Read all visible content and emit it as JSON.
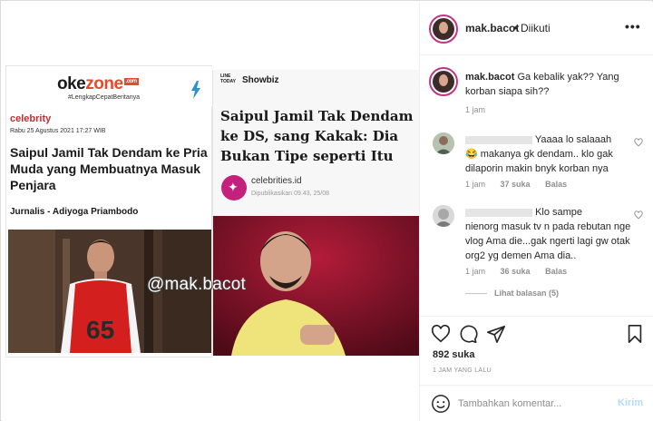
{
  "left_article": {
    "brand_oke": "OKE",
    "brand_zone": "ZONE",
    "brand_badge": ".com",
    "tagline": "#LengkapCepatBeritanya",
    "category": "celebrity",
    "date": "Rabu 25 Agustus 2021 17:27 WIB",
    "title": "Saipul Jamil Tak Dendam ke Pria Muda yang Membuatnya Masuk Penjara",
    "author": "Jurnalis - Adiyoga Priambodo",
    "jersey_number": "65"
  },
  "right_article": {
    "logo": "LINE TODAY",
    "section": "Showbiz",
    "title": "Saipul Jamil Tak Dendam ke DS, sang Kakak: Dia Bukan Tipe seperti Itu",
    "source": "celebrities.id",
    "published": "Dipublikasikan 09.43, 25/08"
  },
  "watermark": "@mak.bacot",
  "header": {
    "username": "mak.bacot",
    "separator": "•",
    "follow_status": "Diikuti",
    "more": "•••"
  },
  "caption": {
    "username": "mak.bacot",
    "text": "Ga kebalik yak?? Yang korban siapa sih??",
    "time": "1 jam"
  },
  "comments": [
    {
      "text_line1": "Yaaaa lo salaaah",
      "text_rest": "makanya gk dendam.. klo gak dilaporin makin bnyk korban nya",
      "emoji": "😂",
      "time": "1 jam",
      "likes": "37 suka",
      "reply": "Balas"
    },
    {
      "text_line1": "Klo sampe",
      "text_rest": "nienorg masuk tv n pada rebutan nge vlog Ama die...gak ngerti lagi gw otak org2 yg demen Ama dia..",
      "time": "1 jam",
      "likes": "36 suka",
      "reply": "Balas",
      "view_replies": "Lihat balasan (5)"
    }
  ],
  "actions": {
    "likes": "892 suka",
    "posted_ago": "1 JAM YANG LALU"
  },
  "add_comment": {
    "placeholder": "Tambahkan komentar...",
    "send": "Kirim"
  },
  "icons": [
    "bolt-icon",
    "heart-icon",
    "comment-icon",
    "share-icon",
    "bookmark-icon",
    "emoji-icon"
  ],
  "colors": {
    "okezone_red": "#e24b2d",
    "category_red": "#c22d2d",
    "celebrities_magenta": "#c4217d",
    "story_ring": "#c13584",
    "send_disabled": "#b3dbff",
    "muted": "#8e8e8e"
  }
}
